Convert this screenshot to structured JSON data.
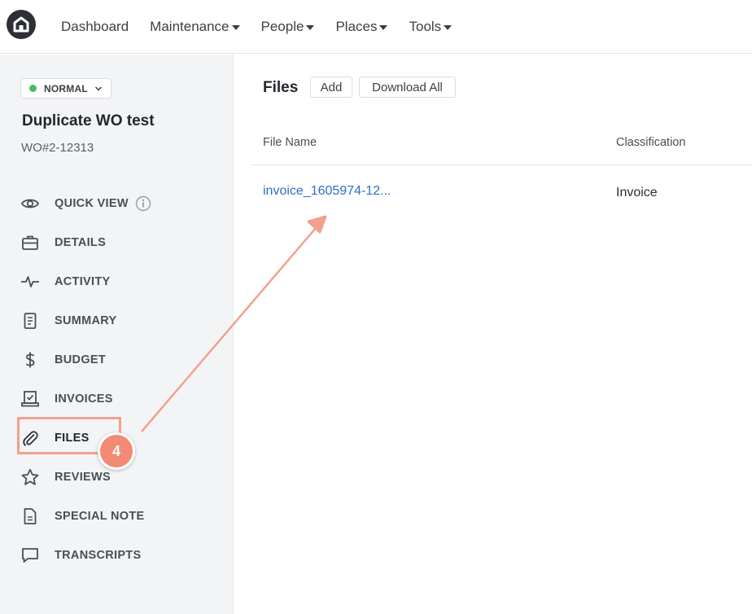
{
  "nav": {
    "items": [
      "Dashboard",
      "Maintenance",
      "People",
      "Places",
      "Tools"
    ]
  },
  "work_order": {
    "status": "NORMAL",
    "title": "Duplicate WO test",
    "number": "WO#2-12313"
  },
  "sidebar": {
    "items": [
      {
        "label": "QUICK VIEW",
        "icon": "eye-icon"
      },
      {
        "label": "DETAILS",
        "icon": "briefcase-icon"
      },
      {
        "label": "ACTIVITY",
        "icon": "pulse-icon"
      },
      {
        "label": "SUMMARY",
        "icon": "document-icon"
      },
      {
        "label": "BUDGET",
        "icon": "dollar-icon"
      },
      {
        "label": "INVOICES",
        "icon": "invoice-icon"
      },
      {
        "label": "FILES",
        "icon": "paperclip-icon"
      },
      {
        "label": "REVIEWS",
        "icon": "star-icon"
      },
      {
        "label": "SPECIAL NOTE",
        "icon": "note-icon"
      },
      {
        "label": "TRANSCRIPTS",
        "icon": "chat-icon"
      }
    ],
    "active": "FILES"
  },
  "annotation": {
    "step": "4",
    "color": "#f28a75"
  },
  "files": {
    "title": "Files",
    "add_label": "Add",
    "download_label": "Download All",
    "columns": [
      "File Name",
      "Classification"
    ],
    "rows": [
      {
        "name": "invoice_1605974-12...",
        "classification": "Invoice"
      }
    ]
  },
  "colors": {
    "link": "#2f6ec7",
    "status_dot": "#4cbb5f",
    "sidebar_bg": "#f3f4f6"
  }
}
